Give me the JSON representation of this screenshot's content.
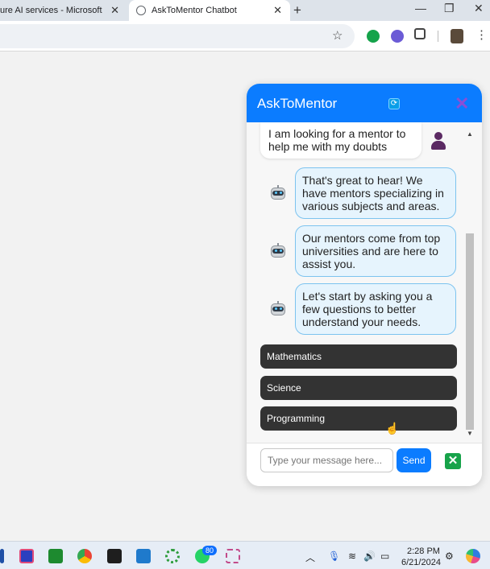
{
  "browser": {
    "tabs": [
      {
        "label": "ure AI services - Microsoft Az"
      },
      {
        "label": "AskToMentor Chatbot"
      }
    ],
    "new_tab_glyph": "+",
    "close_glyph": "✕"
  },
  "chatbot": {
    "title": "AskToMentor",
    "messages": [
      {
        "sender": "user",
        "text": "I am looking for a mentor to help me with my doubts"
      },
      {
        "sender": "bot",
        "text": "That's great to hear! We have mentors specializing in various subjects and areas."
      },
      {
        "sender": "bot",
        "text": "Our mentors come from top universities and are here to assist you."
      },
      {
        "sender": "bot",
        "text": "Let's start by asking you a few questions to better understand your needs."
      }
    ],
    "options": [
      {
        "label": "Mathematics"
      },
      {
        "label": "Science"
      },
      {
        "label": "Programming"
      }
    ],
    "input": {
      "placeholder": "Type your message here...",
      "value": ""
    },
    "send_label": "Send"
  },
  "taskbar": {
    "whatsapp_badge": "80",
    "time": "2:28 PM",
    "date": "6/21/2024"
  },
  "colors": {
    "header": "#0b7cff",
    "bot_bubble": "#e6f4fd",
    "option_button": "#333333",
    "send_button": "#0b7cff"
  }
}
